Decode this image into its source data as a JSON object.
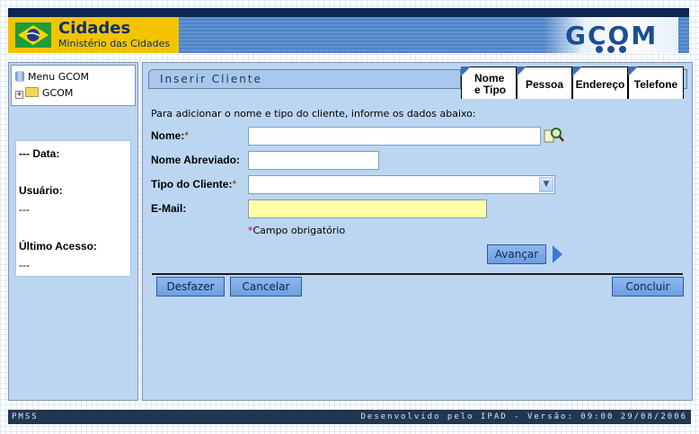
{
  "header": {
    "brand_title": "Cidades",
    "brand_subtitle": "Ministério das Cidades",
    "system_logo": "GCOM",
    "colors": {
      "top_bar": "#0d2750",
      "band": "#5a8fcf",
      "brand_bg": "#f2c400"
    }
  },
  "sidebar": {
    "tree": [
      {
        "label": "Menu GCOM",
        "icon": "database-icon"
      },
      {
        "label": "GCOM",
        "icon": "folder-icon",
        "expand": "+"
      }
    ],
    "info": {
      "data_label": "--- Data:",
      "usuario_label": "Usuário:",
      "usuario_value": "---",
      "ultimo_acesso_label": "Último Acesso:",
      "ultimo_acesso_value": "---"
    }
  },
  "main": {
    "title": "Inserir Cliente",
    "tabs": [
      {
        "line1": "Nome",
        "line2": "e Tipo",
        "active": true
      },
      {
        "label": "Pessoa"
      },
      {
        "label": "Endereço"
      },
      {
        "label": "Telefone"
      }
    ],
    "instructions": "Para adicionar o nome e tipo do cliente, informe os dados abaixo:",
    "form": {
      "nome": {
        "label": "Nome:",
        "required": "*",
        "value": ""
      },
      "nome_abreviado": {
        "label": "Nome Abreviado:",
        "value": ""
      },
      "tipo_cliente": {
        "label": "Tipo do Cliente:",
        "required": "*",
        "value": ""
      },
      "email": {
        "label": "E-Mail:",
        "value": ""
      },
      "required_marker": "*",
      "required_note": "Campo obrigatório"
    },
    "buttons": {
      "avancar": "Avançar",
      "desfazer": "Desfazer",
      "cancelar": "Cancelar",
      "concluir": "Concluir"
    }
  },
  "footer": {
    "left": "PMSS",
    "right": "Desenvolvido pelo IPAD - Versão: 09:00 29/08/2006"
  }
}
